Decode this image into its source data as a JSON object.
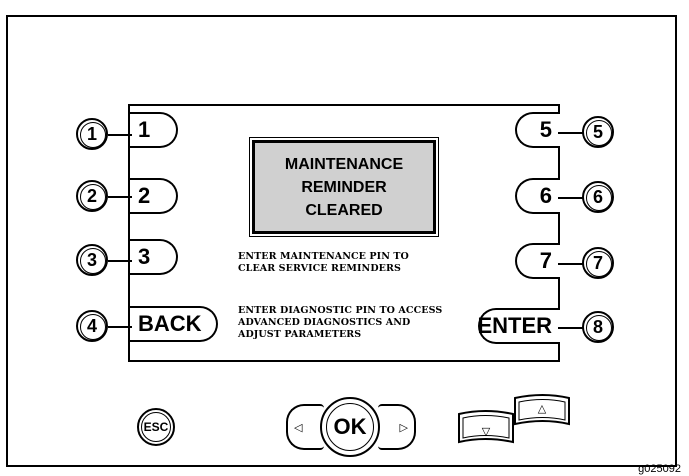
{
  "screen": {
    "status_lines": [
      "MAINTENANCE",
      "REMINDER",
      "CLEARED"
    ],
    "hint_maintenance": [
      "ENTER MAINTENANCE PIN TO",
      "CLEAR SERVICE REMINDERS"
    ],
    "hint_diagnostic": [
      "ENTER DIAGNOSTIC PIN TO ACCESS",
      "ADVANCED DIAGNOSTICS AND",
      "ADJUST PARAMETERS"
    ]
  },
  "softkeys": {
    "left": [
      "1",
      "2",
      "3",
      "BACK"
    ],
    "right": [
      "5",
      "6",
      "7",
      "ENTER"
    ]
  },
  "callouts": {
    "left": [
      "1",
      "2",
      "3",
      "4"
    ],
    "right": [
      "5",
      "6",
      "7",
      "8"
    ]
  },
  "nav": {
    "esc_label": "ESC",
    "ok_label": "OK",
    "left_arrow": "◁",
    "right_arrow": "▷",
    "down_arrow": "▽",
    "up_arrow": "△"
  },
  "figure_code": "g025092"
}
